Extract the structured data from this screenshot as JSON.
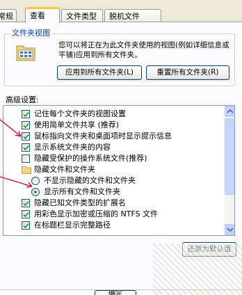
{
  "tabs": [
    {
      "label": "常规"
    },
    {
      "label": "查看"
    },
    {
      "label": "文件类型"
    },
    {
      "label": "脱机文件"
    }
  ],
  "active_tab": "查看",
  "folder_views": {
    "title": "文件夹视图",
    "description": "您可以将正在为此文件夹使用的视图(例如详细信息或平铺)应用到所有文件夹。",
    "apply_label": "应用到所有文件夹(L)",
    "reset_label": "重置所有文件夹(R)"
  },
  "advanced": {
    "label": "高级设置:",
    "items": [
      {
        "type": "checkbox",
        "checked": true,
        "indent": 0,
        "label": "记住每个文件夹的视图设置"
      },
      {
        "type": "checkbox",
        "checked": true,
        "indent": 0,
        "label": "使用简单文件共享 (推荐)"
      },
      {
        "type": "checkbox",
        "checked": true,
        "indent": 0,
        "label": "鼠标指向文件夹和桌面项时显示提示信息"
      },
      {
        "type": "checkbox",
        "checked": true,
        "indent": 0,
        "label": "显示系统文件夹的内容"
      },
      {
        "type": "checkbox",
        "checked": false,
        "indent": 0,
        "label": "隐藏受保护的操作系统文件(推荐)"
      },
      {
        "type": "folder",
        "indent": 0,
        "label": "隐藏文件和文件夹"
      },
      {
        "type": "radio",
        "checked": false,
        "indent": 1,
        "label": "不显示隐藏的文件和文件夹"
      },
      {
        "type": "radio",
        "checked": true,
        "indent": 1,
        "label": "显示所有文件和文件夹"
      },
      {
        "type": "checkbox",
        "checked": true,
        "indent": 0,
        "label": "隐藏已知文件类型的扩展名"
      },
      {
        "type": "checkbox",
        "checked": true,
        "indent": 0,
        "label": "用彩色显示加密或压缩的 NTFS 文件"
      },
      {
        "type": "checkbox",
        "checked": true,
        "indent": 0,
        "label": "在标题栏显示完整路径"
      }
    ]
  },
  "restore_label": "还原为默认值",
  "ok_label": "确定",
  "colors": {
    "accent": "#0046d5",
    "check": "#21a121",
    "annotation_arrow": "#cc0033"
  }
}
